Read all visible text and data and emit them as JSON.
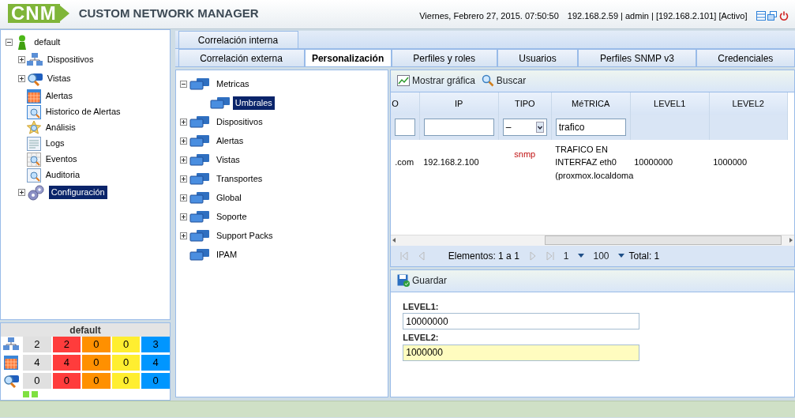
{
  "header": {
    "logo": "CNM",
    "product": "CUSTOM NETWORK MANAGER",
    "datetime": "Viernes, Febrero 27, 2015. 07:50:50",
    "session": "192.168.2.59 | admin | [192.168.2.101] [Activo]"
  },
  "nav_tree": {
    "label": "default",
    "expanded": true,
    "children": [
      {
        "label": "Dispositivos",
        "kind": "devices",
        "expandable": true,
        "selected": false
      },
      {
        "label": "Vistas",
        "kind": "views",
        "expandable": true,
        "selected": false
      },
      {
        "label": "Alertas",
        "kind": "alerts",
        "expandable": false,
        "selected": false
      },
      {
        "label": "Historico de Alertas",
        "kind": "history",
        "expandable": false,
        "selected": false
      },
      {
        "label": "Análisis",
        "kind": "analysis",
        "expandable": false,
        "selected": false
      },
      {
        "label": "Logs",
        "kind": "logs",
        "expandable": false,
        "selected": false
      },
      {
        "label": "Eventos",
        "kind": "events",
        "expandable": false,
        "selected": false
      },
      {
        "label": "Auditoria",
        "kind": "audit",
        "expandable": false,
        "selected": false
      },
      {
        "label": "Configuración",
        "kind": "config",
        "expandable": true,
        "selected": true
      }
    ]
  },
  "summary": {
    "title": "default",
    "rows": [
      {
        "kind": "devices",
        "cells": [
          {
            "value": "2",
            "color": "#e0e0e0"
          },
          {
            "value": "2",
            "color": "#ff3c3c"
          },
          {
            "value": "0",
            "color": "#ff9000"
          },
          {
            "value": "0",
            "color": "#ffee30"
          },
          {
            "value": "3",
            "color": "#0096ff"
          }
        ]
      },
      {
        "kind": "alerts",
        "cells": [
          {
            "value": "4",
            "color": "#e0e0e0"
          },
          {
            "value": "4",
            "color": "#ff3c3c"
          },
          {
            "value": "0",
            "color": "#ff9000"
          },
          {
            "value": "0",
            "color": "#ffee30"
          },
          {
            "value": "4",
            "color": "#0096ff"
          }
        ]
      },
      {
        "kind": "views",
        "cells": [
          {
            "value": "0",
            "color": "#e0e0e0"
          },
          {
            "value": "0",
            "color": "#ff3c3c"
          },
          {
            "value": "0",
            "color": "#ff9000"
          },
          {
            "value": "0",
            "color": "#ffee30"
          },
          {
            "value": "0",
            "color": "#0096ff"
          }
        ]
      }
    ]
  },
  "tabs": [
    [
      {
        "label": "Correlación interna",
        "selected": false
      }
    ],
    [
      {
        "label": "Correlación externa",
        "selected": false
      },
      {
        "label": "Personalización",
        "selected": true
      },
      {
        "label": "Perfiles y roles",
        "selected": false
      },
      {
        "label": "Usuarios",
        "selected": false
      },
      {
        "label": "Perfiles SNMP v3",
        "selected": false
      },
      {
        "label": "Credenciales",
        "selected": false
      }
    ]
  ],
  "config_tree": [
    {
      "label": "Metricas",
      "expanded": true,
      "selected": false,
      "children": [
        {
          "label": "Umbrales",
          "selected": true
        }
      ]
    },
    {
      "label": "Dispositivos",
      "expanded": false,
      "selected": false
    },
    {
      "label": "Alertas",
      "expanded": false,
      "selected": false
    },
    {
      "label": "Vistas",
      "expanded": false,
      "selected": false
    },
    {
      "label": "Transportes",
      "expanded": false,
      "selected": false
    },
    {
      "label": "Global",
      "expanded": false,
      "selected": false
    },
    {
      "label": "Soporte",
      "expanded": false,
      "selected": false
    },
    {
      "label": "Support Packs",
      "expanded": false,
      "selected": false
    },
    {
      "label": "IPAM",
      "selected": false
    }
  ],
  "grid_toolbar": [
    {
      "label": "Mostrar gráfica",
      "kind": "chart"
    },
    {
      "label": "Buscar",
      "kind": "search"
    }
  ],
  "table": {
    "columns": [
      "O",
      "IP",
      "TIPO",
      "MéTRICA",
      "LEVEL1",
      "LEVEL2"
    ],
    "filters": [
      {
        "kind": "text"
      },
      {
        "kind": "text"
      },
      {
        "kind": "select",
        "value": "–"
      },
      {
        "kind": "text",
        "value": "trafico"
      },
      {
        "kind": "none"
      },
      {
        "kind": "none"
      }
    ],
    "rows": [
      [
        ".com",
        "192.168.2.100",
        "snmp",
        "TRAFICO EN INTERFAZ eth0 (proxmox.localdoma",
        "10000000",
        "1000000"
      ]
    ]
  },
  "pager": {
    "range": "Elementos: 1 a 1",
    "page": "1",
    "page_size": "100",
    "total_label": "Total:",
    "total": "1"
  },
  "form": {
    "save": "Guardar",
    "fields": [
      {
        "label": "LEVEL1:",
        "value": "10000000",
        "highlighted": false
      },
      {
        "label": "LEVEL2:",
        "value": "1000000",
        "highlighted": true
      }
    ]
  }
}
